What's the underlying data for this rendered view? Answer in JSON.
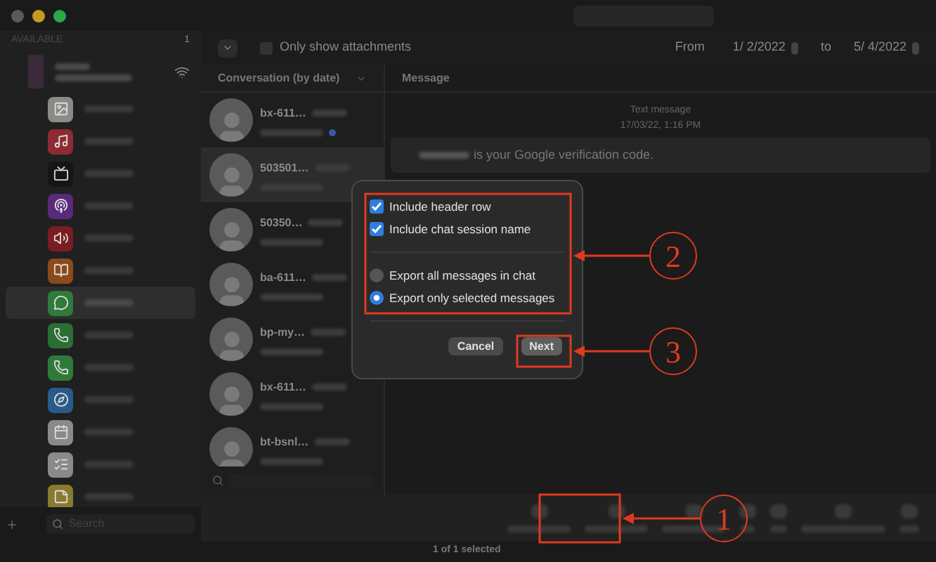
{
  "sidebar": {
    "heading": "AVAILABLE",
    "count": "1",
    "apps": [
      {
        "kind": "photos",
        "selected": false
      },
      {
        "kind": "music",
        "selected": false
      },
      {
        "kind": "tv",
        "selected": false
      },
      {
        "kind": "podcasts",
        "selected": false
      },
      {
        "kind": "ringtones",
        "selected": false
      },
      {
        "kind": "books",
        "selected": false
      },
      {
        "kind": "messages",
        "selected": true
      },
      {
        "kind": "whatsapp",
        "selected": false
      },
      {
        "kind": "phone",
        "selected": false
      },
      {
        "kind": "safari",
        "selected": false
      },
      {
        "kind": "calendar",
        "selected": false
      },
      {
        "kind": "reminders",
        "selected": false
      },
      {
        "kind": "notes",
        "selected": false
      }
    ],
    "search": {
      "placeholder": "Search"
    }
  },
  "filter": {
    "attachments": {
      "label": "Only show attachments",
      "checked": false
    },
    "from_label": "From",
    "from_date": "1/ 2/2022",
    "to_label": "to",
    "to_date": "5/ 4/2022"
  },
  "conversations": {
    "header": "Conversation (by date)",
    "items": [
      {
        "name": "bx-611…",
        "selected": false,
        "unread": true
      },
      {
        "name": "503501…",
        "selected": true,
        "unread": false
      },
      {
        "name": "50350…",
        "selected": false,
        "unread": false
      },
      {
        "name": "ba-611…",
        "selected": false,
        "unread": false
      },
      {
        "name": "bp-my…",
        "selected": false,
        "unread": false
      },
      {
        "name": "bx-611…",
        "selected": false,
        "unread": false
      },
      {
        "name": "bt-bsnl…",
        "selected": false,
        "unread": false
      }
    ]
  },
  "message": {
    "header": "Message",
    "kind_label": "Text message",
    "timestamp": "17/03/22, 1:16 PM",
    "text": "is your Google verification code."
  },
  "dialog": {
    "options": [
      {
        "kind": "checkbox",
        "label": "Include header row",
        "checked": true
      },
      {
        "kind": "checkbox",
        "label": "Include chat session name",
        "checked": true
      },
      {
        "kind": "radio",
        "label": "Export all messages in chat",
        "selected": false
      },
      {
        "kind": "radio",
        "label": "Export only selected messages",
        "selected": true
      }
    ],
    "buttons": [
      {
        "label": "Cancel",
        "default": false
      },
      {
        "label": "Next",
        "default": true
      }
    ]
  },
  "status_bar": {
    "text": "1 of 1 selected"
  },
  "annotations": [
    {
      "number": "1"
    },
    {
      "number": "2"
    },
    {
      "number": "3"
    }
  ]
}
